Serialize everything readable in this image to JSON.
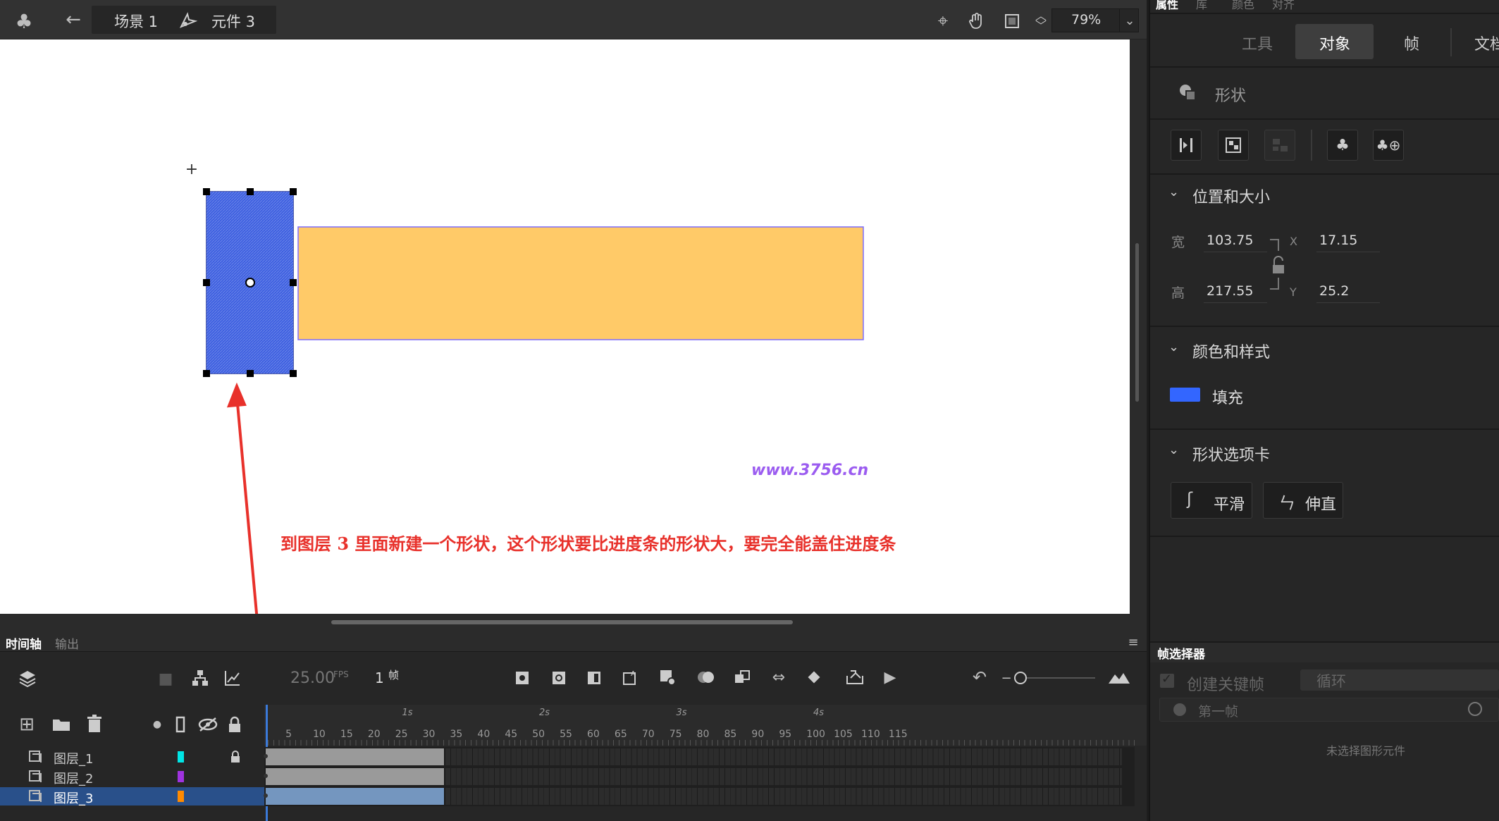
{
  "header": {
    "scene": "场景 1",
    "symbol": "元件 3",
    "zoom": "79%"
  },
  "stage": {
    "watermark": "www.3756.cn",
    "annotation": "到图层 3 里面新建一个形状，这个形状要比进度条的形状大，要完全能盖住进度条",
    "blue_color": "#3d5fe0",
    "orange_color": "#ffca68",
    "annotation_color": "#e8312b",
    "watermark_color": "#9b5cf0"
  },
  "timeline": {
    "tabs": [
      "时间轴",
      "输出"
    ],
    "fps": "25.00",
    "fps_unit": "FPS",
    "frame": "1",
    "frame_unit": "帧",
    "ruler_seconds": [
      "1s",
      "2s",
      "3s",
      "4s"
    ],
    "ruler_numbers": [
      "5",
      "10",
      "15",
      "20",
      "25",
      "30",
      "35",
      "40",
      "45",
      "50",
      "55",
      "60",
      "65",
      "70",
      "75",
      "80",
      "85",
      "90",
      "95",
      "100",
      "105",
      "110",
      "115"
    ],
    "layers": [
      {
        "name": "图层_1",
        "color": "#00e5e5",
        "locked": true,
        "selected": false
      },
      {
        "name": "图层_2",
        "color": "#a033e0",
        "locked": false,
        "selected": false
      },
      {
        "name": "图层_3",
        "color": "#ff8a00",
        "locked": false,
        "selected": true
      }
    ]
  },
  "panel": {
    "top_tabs": [
      "属性",
      "库",
      "颜色",
      "对齐"
    ],
    "mode_tabs": [
      "工具",
      "对象",
      "帧",
      "文档"
    ],
    "shape_title": "形状",
    "pos_section": "位置和大小",
    "width_label": "宽",
    "width": "103.75",
    "height_label": "高",
    "height": "217.55",
    "x_label": "X",
    "x": "17.15",
    "y_label": "Y",
    "y": "25.2",
    "color_section": "颜色和样式",
    "fill_label": "填充",
    "fill_color": "#3366ff",
    "shape_opts_section": "形状选项卡",
    "smooth_label": "平滑",
    "straighten_label": "伸直",
    "frame_picker_title": "帧选择器",
    "create_keyframe": "创建关键帧",
    "loop": "循环",
    "first_frame": "第一帧",
    "no_symbol": "未选择图形元件"
  }
}
